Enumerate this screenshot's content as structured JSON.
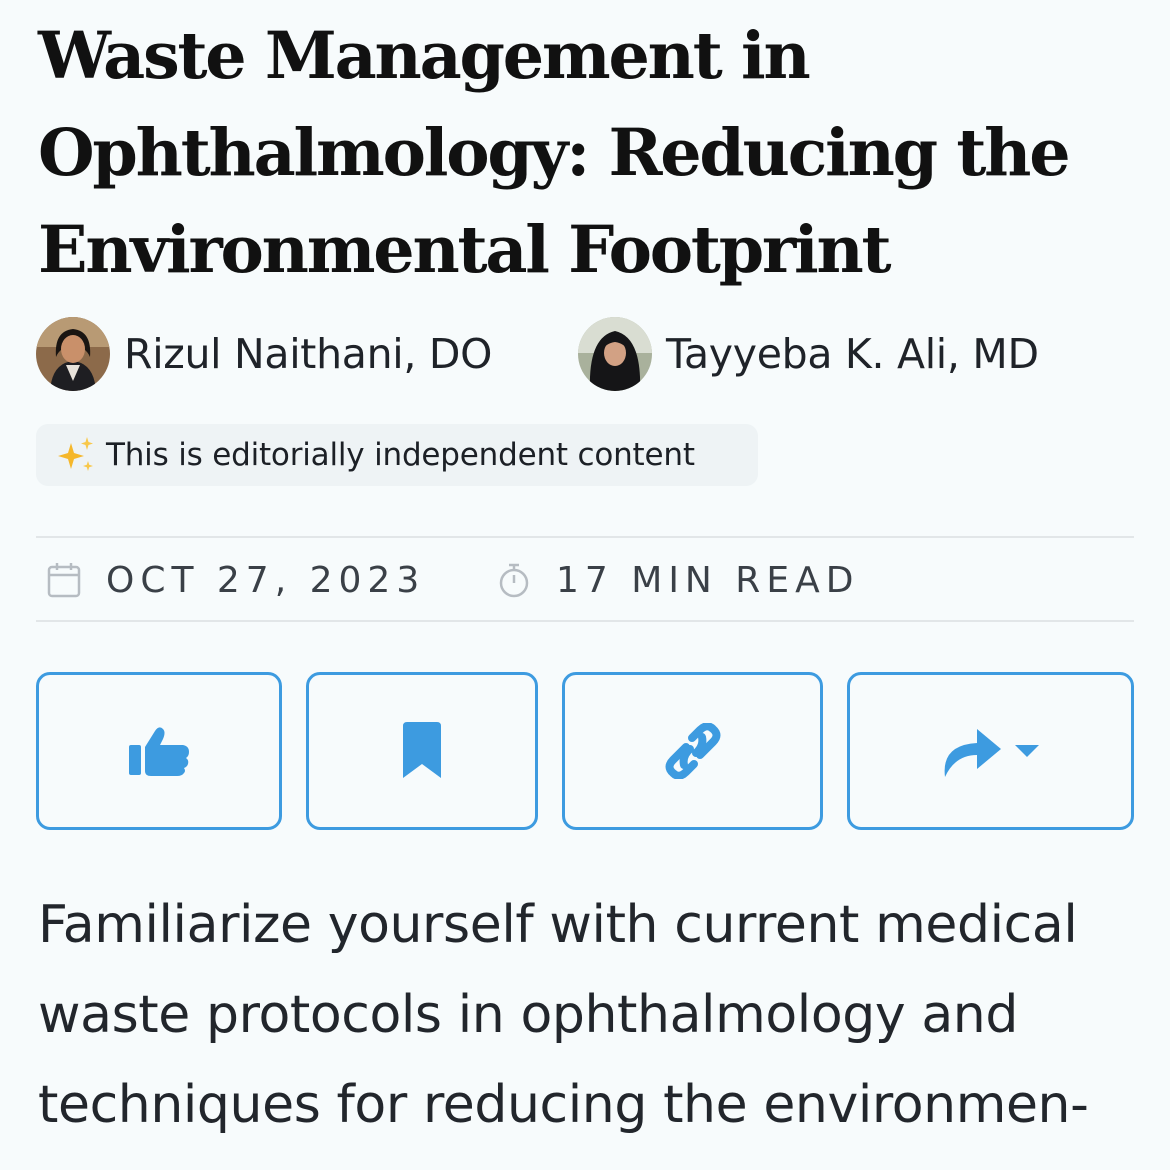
{
  "article": {
    "title_lines": [
      "Waste Management in",
      "Ophthalmology: Reducing the",
      "Environmental Footprint"
    ],
    "authors": [
      {
        "name": "Rizul Naithani, DO",
        "avatar": "author-photo"
      },
      {
        "name": "Tayyeba K. Ali, MD",
        "avatar": "author-photo"
      }
    ],
    "badge": {
      "icon": "sparkles-icon",
      "text": "This is editorially independent content"
    },
    "meta": {
      "date_icon": "calendar-icon",
      "date": "OCT 27, 2023",
      "read_icon": "stopwatch-icon",
      "read_time": "17 MIN READ"
    },
    "actions": [
      {
        "name": "like",
        "icon": "thumbs-up-icon"
      },
      {
        "name": "bookmark",
        "icon": "bookmark-icon"
      },
      {
        "name": "copy-link",
        "icon": "link-icon"
      },
      {
        "name": "share",
        "icon": "share-icon"
      }
    ],
    "intro_lines": [
      "Familiarize yourself with current medical",
      "waste protocols in ophthalmology and",
      "techniques for reducing the environmen-"
    ]
  },
  "colors": {
    "accent": "#3d9be0",
    "background": "#f7fbfc",
    "badge_bg": "#eef3f5",
    "sparkle": "#f5b72b"
  }
}
